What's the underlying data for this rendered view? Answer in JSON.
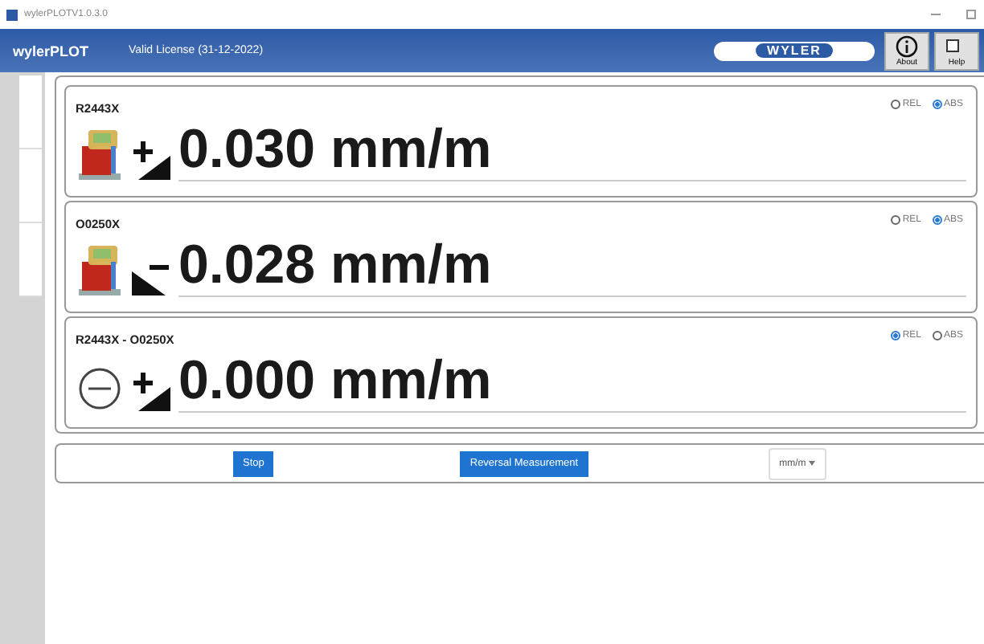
{
  "window": {
    "title": "wylerPLOTV1.0.3.0"
  },
  "header": {
    "app_name": "wylerPLOT",
    "license": "Valid License (31-12-2022)",
    "logo": "WYLER",
    "buttons": [
      {
        "label": "About",
        "kind": "info"
      },
      {
        "label": "Help",
        "kind": "help"
      }
    ]
  },
  "panels": [
    {
      "title": "R2443X",
      "icons": [
        {
          "kind": "inclinometer"
        },
        {
          "kind": "rising"
        }
      ],
      "value": "0.030 mm/m",
      "modes": [
        {
          "label": "REL",
          "selected": false
        },
        {
          "label": "ABS",
          "selected": true
        }
      ]
    },
    {
      "title": "O0250X",
      "icons": [
        {
          "kind": "inclinometer"
        },
        {
          "kind": "falling"
        }
      ],
      "value": "0.028 mm/m",
      "modes": [
        {
          "label": "REL",
          "selected": false
        },
        {
          "label": "ABS",
          "selected": true
        }
      ]
    },
    {
      "title": "R2443X - O0250X",
      "icons": [
        {
          "kind": "difference"
        },
        {
          "kind": "rising"
        }
      ],
      "value": "0.000 mm/m",
      "modes": [
        {
          "label": "REL",
          "selected": true
        },
        {
          "label": "ABS",
          "selected": false
        }
      ]
    }
  ],
  "actions": {
    "buttons": [
      "Stop",
      "Reversal Measurement"
    ],
    "unit": "mm/m"
  }
}
